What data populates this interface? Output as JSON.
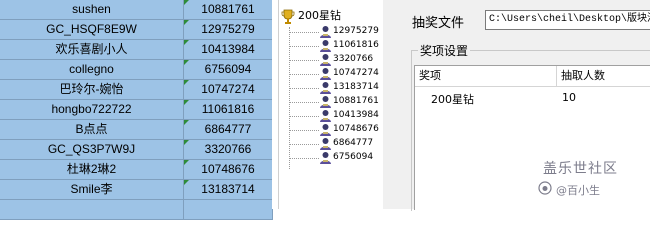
{
  "sheet": {
    "rows": [
      {
        "name": "sushen",
        "id": "10881761"
      },
      {
        "name": "GC_HSQF8E9W",
        "id": "12975279"
      },
      {
        "name": "欢乐喜剧小人",
        "id": "10413984"
      },
      {
        "name": "collegno",
        "id": "6756094"
      },
      {
        "name": "巴玲尔-婉怡",
        "id": "10747274"
      },
      {
        "name": "hongbo722722",
        "id": "11061816"
      },
      {
        "name": "B点点",
        "id": "6864777"
      },
      {
        "name": "GC_QS3P7W9J",
        "id": "3320766"
      },
      {
        "name": "杜琳2琳2",
        "id": "10748676"
      },
      {
        "name": "Smile李",
        "id": "13183714"
      },
      {
        "name": "",
        "id": ""
      }
    ]
  },
  "tree": {
    "root_label": "200星钻",
    "nodes": [
      "12975279",
      "11061816",
      "3320766",
      "10747274",
      "13183714",
      "10881761",
      "10413984",
      "10748676",
      "6864777",
      "6756094"
    ]
  },
  "panel": {
    "file_label": "抽奖文件",
    "file_path": "C:\\Users\\cheil\\Desktop\\版块活",
    "group_title": "奖项设置",
    "columns": [
      "奖项",
      "抽取人数"
    ],
    "rows": [
      {
        "prize": "200星钻",
        "count": "10"
      }
    ]
  },
  "watermark": {
    "title": "盖乐世社区",
    "subtitle": "@百小生"
  },
  "colors": {
    "cell_fill": "#9dc3e6",
    "grid": "#7f9fbe",
    "panel_bg": "#f0f0f0"
  }
}
